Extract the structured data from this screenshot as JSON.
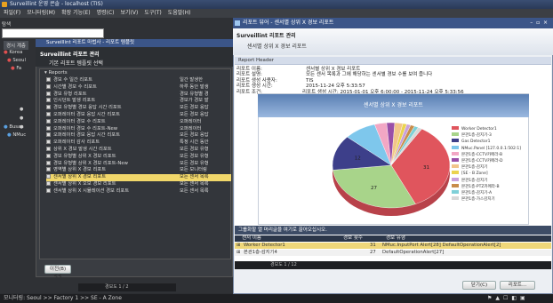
{
  "app": {
    "title": "Surveillint 운영 콘솔 - localhost (TIS)",
    "menu": [
      "파일(F)",
      "모니터링(M)",
      "확장 기능(E)",
      "명령(C)",
      "보기(V)",
      "도구(T)",
      "도움말(H)"
    ]
  },
  "left": {
    "search_label": "탐색",
    "sidebar_tab": "경시 계층",
    "tree": [
      "Korea",
      "Seoul",
      "Fa",
      "Busan",
      "NMuc"
    ]
  },
  "dialog1": {
    "title": "Surveillint 리포트 마법사 - 리포트 템플릿",
    "header_title": "Surveillint 리포트 관리",
    "header_sub": "기본 리포트 템플릿 선택",
    "root": "Reports",
    "items": [
      {
        "label": "경보 수 일간 리포트",
        "desc": "일간 발생한"
      },
      {
        "label": "시간별 경보 수 리포트",
        "desc": "하루 동안 발생"
      },
      {
        "label": "경보 유형 리포트",
        "desc": "경보 유형별 경"
      },
      {
        "label": "인시던트 발생 리포트",
        "desc": "경보가 경보 발"
      },
      {
        "label": "경보 유형별 경보 응답 시간 리포트",
        "desc": "모든 경보 응답"
      },
      {
        "label": "오퍼레이터 경보 응답 시간 리포트",
        "desc": "모든 경보 응답"
      },
      {
        "label": "오퍼레이터 경보 수 리포트",
        "desc": "오퍼레이터"
      },
      {
        "label": "오퍼레이터 경보 수 리포트-New",
        "desc": "오퍼레이터"
      },
      {
        "label": "오퍼레이터 경보 응답 시간 리포트",
        "desc": "모든 경보 응답"
      },
      {
        "label": "오퍼레이터 감사 리포트",
        "desc": "특정 시간 동안"
      },
      {
        "label": "상위 X 경보 발생 시간 리포트",
        "desc": "모든 경보 유형"
      },
      {
        "label": "경보 유형별 상위 X 경보 리포트",
        "desc": "모든 경보 유형"
      },
      {
        "label": "경보 유형별 상위 X 경보 리포트-New",
        "desc": "모든 경보 유형"
      },
      {
        "label": "영역별 상위 X 경보 리포트",
        "desc": "모든 모니터링"
      },
      {
        "label": "센서별 상위 X 경보 리포트",
        "desc": "모든 센서 목록"
      },
      {
        "label": "센서별 상위 X 오보 경보 리포트",
        "desc": "모든 센서 목록"
      },
      {
        "label": "센서별 상위 X 시뮬레이션 경보 리포트",
        "desc": "모든 센서 목록"
      }
    ],
    "selected_index": 14,
    "back_button": "이전(B) <<",
    "tabs": "경보도 1 / 2"
  },
  "report": {
    "window_title": "리포트 뷰어 - 센서별 상위 X 경보 리포트",
    "head_title": "Surveillint 리포트 관리",
    "head_sub": "센서별 상위 X 경보 리포트",
    "section": "Report Header",
    "fields": [
      {
        "k": "리포트 이름:",
        "v": "센서별 상위 X 경보 리포트"
      },
      {
        "k": "리포트 설명:",
        "v": "모든 센서 목록과 그에 해당하는 센서별 경보 수를 보여 줍니다"
      },
      {
        "k": "리포트 생성 사용자:",
        "v": "TIS"
      },
      {
        "k": "리포트 생성 시간:",
        "v": "2015-11-24 오후 5:33:57"
      },
      {
        "k": "리포트 조건:",
        "v": "리포트 생성 시간: 2015-01-01 오후 6:00:00 - 2015-11-24 오후 5:33:56"
      }
    ],
    "table_title": "그룹화할 열 머리글을 여기로 끌어오십시오.",
    "columns": [
      "센서 이름",
      "경보 횟수",
      "경보 유형"
    ],
    "rows": [
      {
        "name": "Worker Detector1",
        "count": "31",
        "type": "NMuc.InputPort Alert[28] DefaultOperationAlert[2]"
      },
      {
        "name": "본관1층-감지기4",
        "count": "27",
        "type": "DefaultOperationAlert[27]"
      }
    ],
    "pager": "경보도 1 / 12",
    "close_button": "닫기(C)",
    "print_button": "리포트..."
  },
  "chart_data": {
    "type": "pie",
    "title": "센서별 상위 X 경보 리포트",
    "series": [
      {
        "name": "Worker Detector1",
        "value": 31,
        "color": "#e0555d"
      },
      {
        "name": "본관1층-감지기-3",
        "value": 27,
        "color": "#a8d48a"
      },
      {
        "name": "Gas Detector1",
        "value": 12,
        "color": "#3d3f8a"
      },
      {
        "name": "NMuc.Panel [127.0.0.1:502:1]",
        "value": 8,
        "color": "#7ec7ec"
      },
      {
        "name": "본관1층-CCTV카메라-B",
        "value": 3,
        "color": "#f2a7c4"
      },
      {
        "name": "본관1층-CCTV카메라-D",
        "value": 2,
        "color": "#9a4fa8"
      },
      {
        "name": "본관1층-감지기",
        "value": 2,
        "color": "#f2c58a"
      },
      {
        "name": "[SE - B Zone]",
        "value": 1,
        "color": "#ebd34f"
      },
      {
        "name": "본관1층-감지기",
        "value": 1,
        "color": "#c9a0dc"
      },
      {
        "name": "본관1층-PTZ카메라-B",
        "value": 1,
        "color": "#c88c4a"
      },
      {
        "name": "본관1층-감지기-A",
        "value": 1,
        "color": "#7fd0d8"
      },
      {
        "name": "본관1층-가스감지기",
        "value": 1,
        "color": "#d8d8d8"
      }
    ],
    "data_labels": [
      "27",
      "31",
      "12"
    ]
  },
  "status": {
    "text": "모니터링: Seoul >> Factory 1 >> SE - A Zone"
  }
}
